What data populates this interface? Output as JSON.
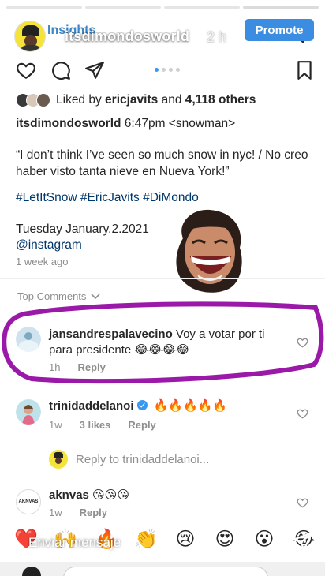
{
  "story": {
    "insights_label": "Insights",
    "username": "itsdimondosworld",
    "time": "2 h",
    "promote_label": "Promote",
    "progress_bars": 4
  },
  "post": {
    "liked_by_prefix": "Liked by ",
    "liked_by_user": "ericjavits",
    "liked_by_middle": " and ",
    "liked_by_count": "4,118 others",
    "caption_user": "itsdimondosworld",
    "caption_text": " 6:47pm <snowman>",
    "quote": "“I don’t think I’ve seen so much snow in nyc! / No creo haber visto tanta nieve en Nueva York!”",
    "hashtags": "#LetItSnow #EricJavits #DiMondo",
    "date": "Tuesday January.2.2021",
    "mention": "@instagram",
    "time_ago": "1 week ago"
  },
  "comments_header": "Top Comments",
  "comments": [
    {
      "user": "jansandrespalavecino",
      "text": " Voy a votar por ti para presidente 😂😂😂😂",
      "time": "1h",
      "likes": "",
      "reply": "Reply"
    },
    {
      "user": "trinidaddelanoi",
      "text": " 🔥🔥🔥🔥🔥",
      "time": "1w",
      "likes": "3 likes",
      "reply": "Reply"
    },
    {
      "user": "aknvas",
      "text": " 😘😘😘",
      "time": "1w",
      "likes": "",
      "reply": "Reply"
    }
  ],
  "reply_thread": "Reply to trinidaddelanoi...",
  "avatar_text": {
    "aknvas": "AKNVAS"
  },
  "message_placeholder": "Enviar mensaje",
  "reactions": [
    "❤️",
    "🙌",
    "🔥",
    "👏",
    "😢",
    "😍",
    "😮",
    "😂"
  ],
  "colors": {
    "link": "#00376b",
    "promote": "#3a8de0",
    "annotation": "#9b19a8",
    "muted": "#8e8e8e"
  }
}
